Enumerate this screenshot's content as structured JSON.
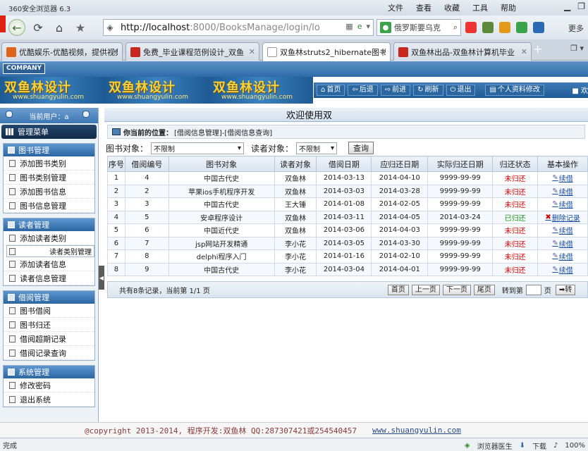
{
  "browser": {
    "app_title": "360安全浏览器 6.3",
    "menus": [
      "文件",
      "查看",
      "收藏",
      "工具",
      "帮助"
    ],
    "address_host": "http://localhost",
    "address_rest": ":8000/BooksManage/login/lo",
    "search_text": "俄罗斯要乌克",
    "more_label": "更多",
    "tabs": [
      {
        "label": "优酷娱乐-优酷视频，提供视频",
        "fav_color": "#e0621b"
      },
      {
        "label": "免费_毕业课程范例设计_双鱼",
        "fav_color": "#c8281e"
      },
      {
        "label": "双鱼林struts2_hibernate图书",
        "fav_color": "#ffffff"
      },
      {
        "label": "双鱼林出品-双鱼林计算机毕业",
        "fav_color": "#c8281e"
      }
    ]
  },
  "header": {
    "company": "COMPANY",
    "brand_cn": "双鱼林设计",
    "brand_en": "www.shuangyulin.com",
    "nav": [
      "首页",
      "后退",
      "前进",
      "刷新",
      "退出"
    ],
    "profile": "个人资料修改",
    "welcome": "欢"
  },
  "sidebar": {
    "current_user": "当前用户：a",
    "menu_title": "管理菜单",
    "groups": [
      {
        "title": "图书管理",
        "items": [
          "添加图书类别",
          "图书类别管理",
          "添加图书信息",
          "图书信息管理"
        ]
      },
      {
        "title": "读者管理",
        "items": [
          "添加读者类别",
          "读者类别管理",
          "添加读者信息",
          "读者信息管理"
        ]
      },
      {
        "title": "借阅管理",
        "items": [
          "图书借阅",
          "图书归还",
          "借阅超期记录",
          "借阅记录查询"
        ]
      },
      {
        "title": "系统管理",
        "items": [
          "修改密码",
          "退出系统"
        ]
      }
    ]
  },
  "main": {
    "heading": "欢迎使用双",
    "crumb_label": "你当前的位置：",
    "crumb_path": "[借阅信息管理]-[借阅信息查询]",
    "filter_book_label": "图书对象：",
    "filter_book_value": "不限制",
    "filter_reader_label": "读者对象：",
    "filter_reader_value": "不限制",
    "query_button": "查询",
    "columns": [
      "序号",
      "借阅编号",
      "图书对象",
      "读者对象",
      "借阅日期",
      "应归还日期",
      "实际归还日期",
      "归还状态",
      "基本操作"
    ],
    "rows": [
      [
        "1",
        "4",
        "中国古代史",
        "双鱼林",
        "2014-03-13",
        "2014-04-10",
        "9999-99-99",
        "未归还",
        "续借"
      ],
      [
        "2",
        "2",
        "苹果ios手机程序开发",
        "双鱼林",
        "2014-03-03",
        "2014-03-28",
        "9999-99-99",
        "未归还",
        "续借"
      ],
      [
        "3",
        "3",
        "中国古代史",
        "王大锤",
        "2014-01-08",
        "2014-02-05",
        "9999-99-99",
        "未归还",
        "续借"
      ],
      [
        "4",
        "5",
        "安卓程序设计",
        "双鱼林",
        "2014-03-11",
        "2014-04-05",
        "2014-03-24",
        "已归还",
        "删除记录"
      ],
      [
        "5",
        "6",
        "中国近代史",
        "双鱼林",
        "2014-03-06",
        "2014-04-03",
        "9999-99-99",
        "未归还",
        "续借"
      ],
      [
        "6",
        "7",
        "jsp网站开发精通",
        "李小花",
        "2014-03-05",
        "2014-03-30",
        "9999-99-99",
        "未归还",
        "续借"
      ],
      [
        "7",
        "8",
        "delphi程序入门",
        "李小花",
        "2014-01-16",
        "2014-02-10",
        "9999-99-99",
        "未归还",
        "续借"
      ],
      [
        "8",
        "9",
        "中国古代史",
        "李小花",
        "2014-03-04",
        "2014-04-01",
        "9999-99-99",
        "未归还",
        "续借"
      ]
    ],
    "pager": {
      "info": "共有8条记录，当前第 1/1 页",
      "first": "首页",
      "prev": "上一页",
      "next": "下一页",
      "last": "尾页",
      "jump_label": "转到第",
      "page_unit": "页",
      "go": "转"
    }
  },
  "footer": {
    "copyright": "@copyright 2013-2014, 程序开发:双鱼林  QQ:287307421或254540457",
    "site": "www.shuangyulin.com"
  },
  "statusbar": {
    "left": "完成",
    "doctor": "浏览器医生",
    "download": "下载",
    "zoom": "100%"
  },
  "colors": {
    "returned": "#1a9a1a",
    "not_returned": "#d00000",
    "accent": "#2b66a3"
  }
}
